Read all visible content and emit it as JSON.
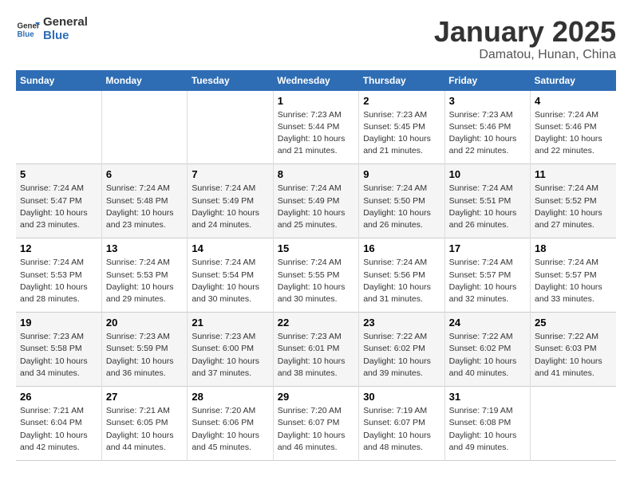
{
  "logo": {
    "general": "General",
    "blue": "Blue"
  },
  "title": "January 2025",
  "subtitle": "Damatou, Hunan, China",
  "days_of_week": [
    "Sunday",
    "Monday",
    "Tuesday",
    "Wednesday",
    "Thursday",
    "Friday",
    "Saturday"
  ],
  "weeks": [
    [
      {
        "day": "",
        "info": ""
      },
      {
        "day": "",
        "info": ""
      },
      {
        "day": "",
        "info": ""
      },
      {
        "day": "1",
        "info": "Sunrise: 7:23 AM\nSunset: 5:44 PM\nDaylight: 10 hours and 21 minutes."
      },
      {
        "day": "2",
        "info": "Sunrise: 7:23 AM\nSunset: 5:45 PM\nDaylight: 10 hours and 21 minutes."
      },
      {
        "day": "3",
        "info": "Sunrise: 7:23 AM\nSunset: 5:46 PM\nDaylight: 10 hours and 22 minutes."
      },
      {
        "day": "4",
        "info": "Sunrise: 7:24 AM\nSunset: 5:46 PM\nDaylight: 10 hours and 22 minutes."
      }
    ],
    [
      {
        "day": "5",
        "info": "Sunrise: 7:24 AM\nSunset: 5:47 PM\nDaylight: 10 hours and 23 minutes."
      },
      {
        "day": "6",
        "info": "Sunrise: 7:24 AM\nSunset: 5:48 PM\nDaylight: 10 hours and 23 minutes."
      },
      {
        "day": "7",
        "info": "Sunrise: 7:24 AM\nSunset: 5:49 PM\nDaylight: 10 hours and 24 minutes."
      },
      {
        "day": "8",
        "info": "Sunrise: 7:24 AM\nSunset: 5:49 PM\nDaylight: 10 hours and 25 minutes."
      },
      {
        "day": "9",
        "info": "Sunrise: 7:24 AM\nSunset: 5:50 PM\nDaylight: 10 hours and 26 minutes."
      },
      {
        "day": "10",
        "info": "Sunrise: 7:24 AM\nSunset: 5:51 PM\nDaylight: 10 hours and 26 minutes."
      },
      {
        "day": "11",
        "info": "Sunrise: 7:24 AM\nSunset: 5:52 PM\nDaylight: 10 hours and 27 minutes."
      }
    ],
    [
      {
        "day": "12",
        "info": "Sunrise: 7:24 AM\nSunset: 5:53 PM\nDaylight: 10 hours and 28 minutes."
      },
      {
        "day": "13",
        "info": "Sunrise: 7:24 AM\nSunset: 5:53 PM\nDaylight: 10 hours and 29 minutes."
      },
      {
        "day": "14",
        "info": "Sunrise: 7:24 AM\nSunset: 5:54 PM\nDaylight: 10 hours and 30 minutes."
      },
      {
        "day": "15",
        "info": "Sunrise: 7:24 AM\nSunset: 5:55 PM\nDaylight: 10 hours and 30 minutes."
      },
      {
        "day": "16",
        "info": "Sunrise: 7:24 AM\nSunset: 5:56 PM\nDaylight: 10 hours and 31 minutes."
      },
      {
        "day": "17",
        "info": "Sunrise: 7:24 AM\nSunset: 5:57 PM\nDaylight: 10 hours and 32 minutes."
      },
      {
        "day": "18",
        "info": "Sunrise: 7:24 AM\nSunset: 5:57 PM\nDaylight: 10 hours and 33 minutes."
      }
    ],
    [
      {
        "day": "19",
        "info": "Sunrise: 7:23 AM\nSunset: 5:58 PM\nDaylight: 10 hours and 34 minutes."
      },
      {
        "day": "20",
        "info": "Sunrise: 7:23 AM\nSunset: 5:59 PM\nDaylight: 10 hours and 36 minutes."
      },
      {
        "day": "21",
        "info": "Sunrise: 7:23 AM\nSunset: 6:00 PM\nDaylight: 10 hours and 37 minutes."
      },
      {
        "day": "22",
        "info": "Sunrise: 7:23 AM\nSunset: 6:01 PM\nDaylight: 10 hours and 38 minutes."
      },
      {
        "day": "23",
        "info": "Sunrise: 7:22 AM\nSunset: 6:02 PM\nDaylight: 10 hours and 39 minutes."
      },
      {
        "day": "24",
        "info": "Sunrise: 7:22 AM\nSunset: 6:02 PM\nDaylight: 10 hours and 40 minutes."
      },
      {
        "day": "25",
        "info": "Sunrise: 7:22 AM\nSunset: 6:03 PM\nDaylight: 10 hours and 41 minutes."
      }
    ],
    [
      {
        "day": "26",
        "info": "Sunrise: 7:21 AM\nSunset: 6:04 PM\nDaylight: 10 hours and 42 minutes."
      },
      {
        "day": "27",
        "info": "Sunrise: 7:21 AM\nSunset: 6:05 PM\nDaylight: 10 hours and 44 minutes."
      },
      {
        "day": "28",
        "info": "Sunrise: 7:20 AM\nSunset: 6:06 PM\nDaylight: 10 hours and 45 minutes."
      },
      {
        "day": "29",
        "info": "Sunrise: 7:20 AM\nSunset: 6:07 PM\nDaylight: 10 hours and 46 minutes."
      },
      {
        "day": "30",
        "info": "Sunrise: 7:19 AM\nSunset: 6:07 PM\nDaylight: 10 hours and 48 minutes."
      },
      {
        "day": "31",
        "info": "Sunrise: 7:19 AM\nSunset: 6:08 PM\nDaylight: 10 hours and 49 minutes."
      },
      {
        "day": "",
        "info": ""
      }
    ]
  ]
}
